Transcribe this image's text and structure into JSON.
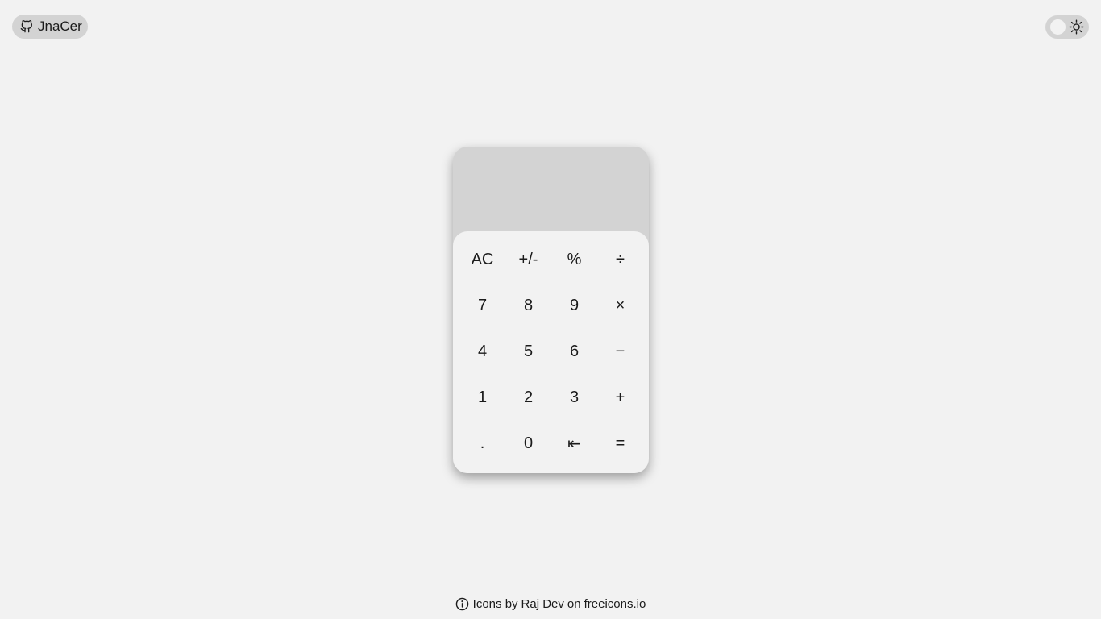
{
  "github": {
    "label": "JnaCer",
    "icon": "github-icon"
  },
  "theme_toggle": {
    "icon": "sun-icon",
    "mode": "light"
  },
  "calculator": {
    "display_value": "",
    "keys": [
      [
        "AC",
        "+/-",
        "%",
        "÷"
      ],
      [
        "7",
        "8",
        "9",
        "×"
      ],
      [
        "4",
        "5",
        "6",
        "−"
      ],
      [
        "1",
        "2",
        "3",
        "+"
      ],
      [
        ".",
        "0",
        "⇤",
        "="
      ]
    ]
  },
  "footer": {
    "icon": "info-icon",
    "prefix": "Icons by",
    "author": "Raj Dev",
    "middle": "on",
    "site": "freeicons.io"
  },
  "colors": {
    "background": "#f2f2f2",
    "surface": "#d3d3d3",
    "text": "#1b1b1b"
  }
}
